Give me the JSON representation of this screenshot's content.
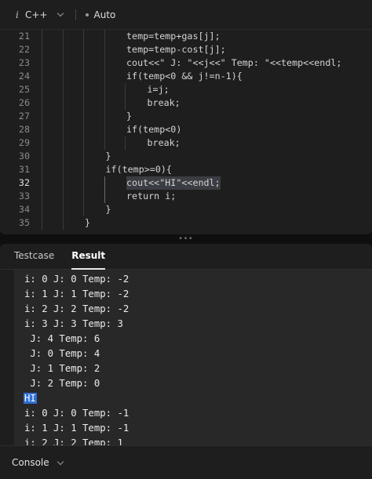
{
  "toolbar": {
    "lang_icon": "i",
    "language": "C++",
    "mode": "Auto"
  },
  "editor": {
    "active_line": "32",
    "lines": [
      {
        "n": "21",
        "text": "temp=temp+gas[j];",
        "indent": 4
      },
      {
        "n": "22",
        "text": "temp=temp-cost[j];",
        "indent": 4
      },
      {
        "n": "23",
        "text": "cout<<\" J: \"<<j<<\" Temp: \"<<temp<<endl;",
        "indent": 4
      },
      {
        "n": "24",
        "text": "if(temp<0 && j!=n-1){",
        "indent": 4
      },
      {
        "n": "25",
        "text": "i=j;",
        "indent": 5
      },
      {
        "n": "26",
        "text": "break;",
        "indent": 5
      },
      {
        "n": "27",
        "text": "}",
        "indent": 4
      },
      {
        "n": "28",
        "text": "if(temp<0)",
        "indent": 4
      },
      {
        "n": "29",
        "text": "break;",
        "indent": 5
      },
      {
        "n": "30",
        "text": "}",
        "indent": 3
      },
      {
        "n": "31",
        "text": "if(temp>=0){",
        "indent": 3
      },
      {
        "n": "32",
        "text": "cout<<\"HI\"<<endl;",
        "indent": 4
      },
      {
        "n": "33",
        "text": "return i;",
        "indent": 4
      },
      {
        "n": "34",
        "text": "}",
        "indent": 3
      },
      {
        "n": "35",
        "text": "}",
        "indent": 2
      }
    ]
  },
  "handle": {
    "grip": "•••"
  },
  "result_tabs": [
    {
      "label": "Testcase",
      "active": false
    },
    {
      "label": "Result",
      "active": true
    }
  ],
  "output": [
    "i: 0 J: 0 Temp: -2",
    "i: 1 J: 1 Temp: -2",
    "i: 2 J: 2 Temp: -2",
    "i: 3 J: 3 Temp: 3",
    " J: 4 Temp: 6",
    " J: 0 Temp: 4",
    " J: 1 Temp: 2",
    " J: 2 Temp: 0",
    "HI",
    "i: 0 J: 0 Temp: -1",
    "i: 1 J: 1 Temp: -1",
    "i: 2 J: 2 Temp: 1"
  ],
  "output_selected_line": "HI",
  "console": {
    "label": "Console"
  }
}
